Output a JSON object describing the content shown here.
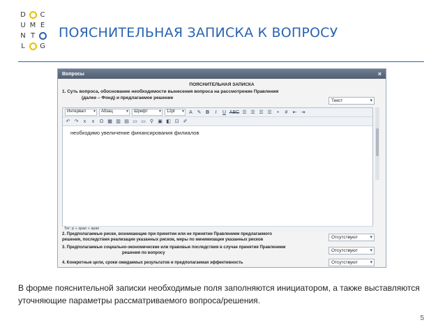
{
  "logo": {
    "cells": [
      "D",
      "",
      "C",
      "U",
      "M",
      "E",
      "N",
      "T",
      "",
      "L",
      "",
      "G"
    ]
  },
  "slide_title": "ПОЯСНИТЕЛЬНАЯ ЗАПИСКА К ВОПРОСУ",
  "window": {
    "title": "Вопросы",
    "close": "×",
    "header": "ПОЯСНИТЕЛЬНАЯ ЗАПИСКА",
    "q1_line1": "1. Суть вопроса, обоснование необходимости вынесения вопроса на рассмотрение Правления",
    "q1_line2": "(далее – Фонд) и предлагаемое решение",
    "q1_select": "Текст",
    "toolbar": {
      "interval": "Интервал",
      "paragraph": "Абзац",
      "font": "Шрифт",
      "size": "12pt",
      "bold": "B",
      "italic": "I",
      "underline": "U",
      "strike": "ABC"
    },
    "editor_text": "необходимо увеличение финансирования филиалов",
    "path": "Тег: p » span » span",
    "q2_line1": "2. Предполагаемые риски, возникающие при принятии или не принятии Правлением                 предлагаемого",
    "q2_line2": "решения, последствия реализации указанных рисков, меры по минимизации указанных рисков",
    "q2_select": "Отсутствуют",
    "q3_line1": "3. Предполагаемые социально-экономические или правовые последствия в случае принятия Правлением",
    "q3_line2": "решения по вопросу",
    "q3_select": "Отсутствуют",
    "q4_line1": "4. Конкретные цели, сроки ожидаемых результатов и предполагаемая эффективность",
    "q4_select": "Отсутствуют"
  },
  "caption": "В форме пояснительной записки необходимые поля заполняются инициатором, а также выставляются уточняющие параметры рассматриваемого вопроса/решения.",
  "page_number": "5",
  "colors": {
    "title": "#2a63b0",
    "logo_yellow": "#e5c100",
    "logo_blue": "#2f5fa8"
  }
}
